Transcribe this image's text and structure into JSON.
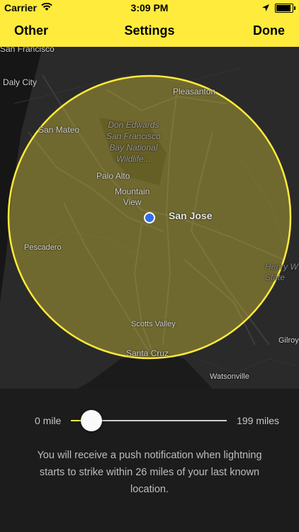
{
  "status_bar": {
    "carrier": "Carrier",
    "time": "3:09 PM",
    "battery_level": 0.9
  },
  "nav": {
    "left_label": "Other",
    "title": "Settings",
    "right_label": "Done"
  },
  "map": {
    "labels": {
      "san_francisco": "San Francisco",
      "daly_city": "Daly City",
      "pleasanton": "Pleasanton",
      "san_mateo": "San Mateo",
      "park_line1": "Don Edwards",
      "park_line2": "San Francisco",
      "park_line3": "Bay National",
      "park_line4": "Wildlife...",
      "palo_alto": "Palo Alto",
      "mountain_view_1": "Mountain",
      "mountain_view_2": "View",
      "san_jose": "San Jose",
      "pescadero": "Pescadero",
      "henry_1": "Henry W",
      "henry_2": "State",
      "scotts_valley": "Scotts Valley",
      "gilroy": "Gilroy",
      "santa_cruz": "Santa Cruz",
      "watsonville": "Watsonville"
    },
    "accent": "#ffeb3b",
    "location_dot_color": "#2f6fe4"
  },
  "slider": {
    "min_label": "0 mile",
    "max_label": "199 miles",
    "min": 0,
    "max": 199,
    "value": 26
  },
  "description": "You will receive a push notification when lightning starts to strike within 26 miles of your last known location."
}
